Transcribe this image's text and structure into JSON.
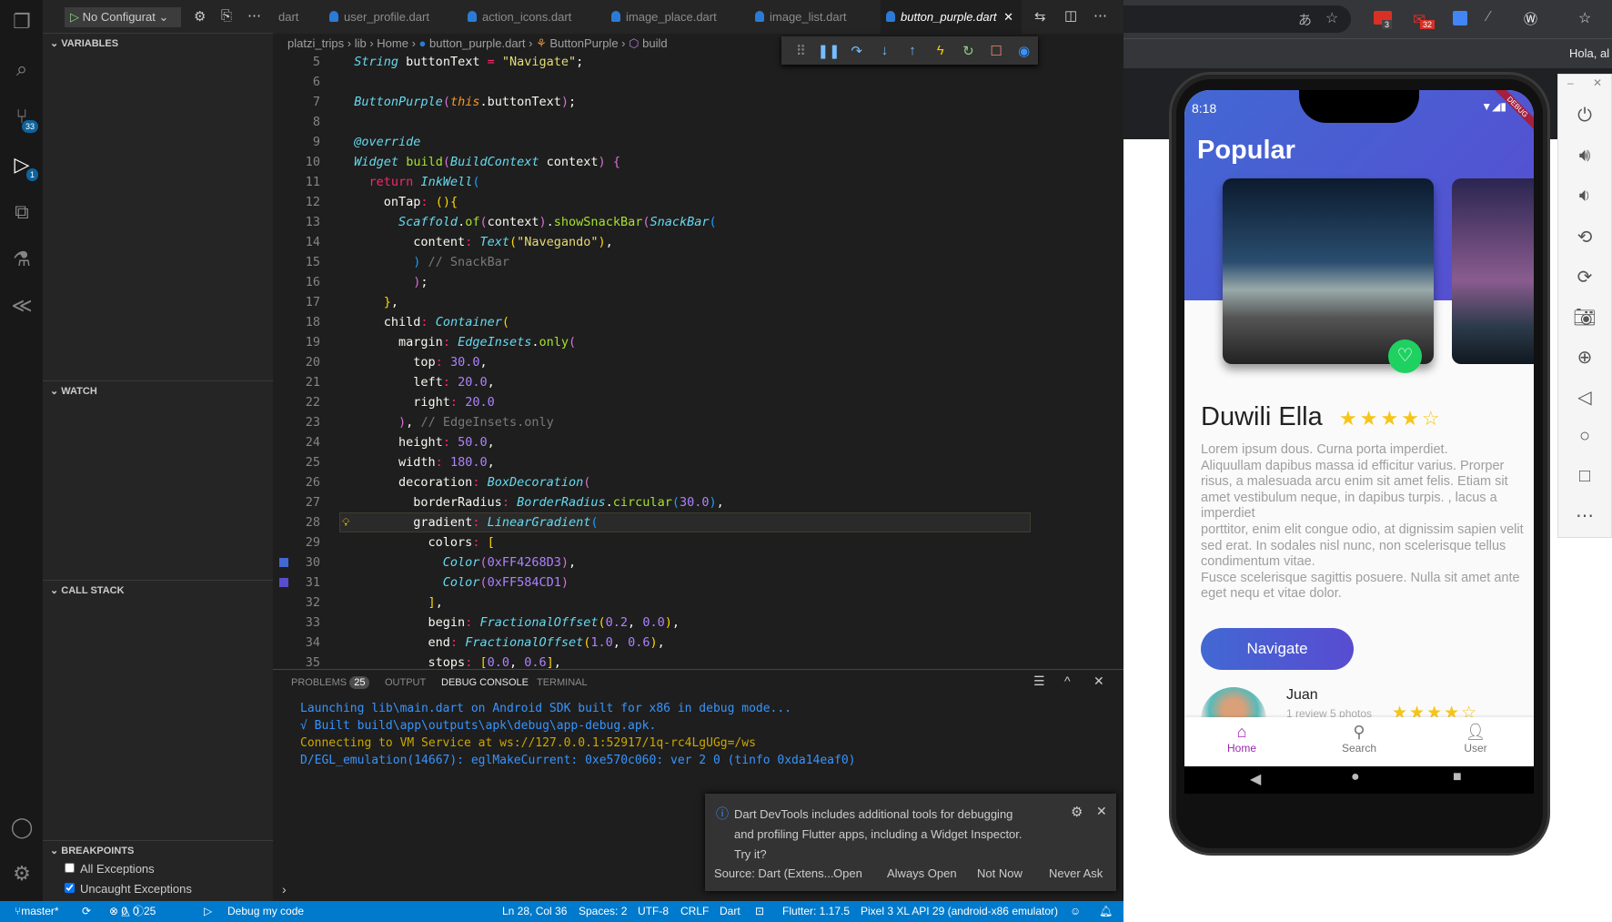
{
  "run": {
    "config": "No Configurat"
  },
  "activity": {
    "scm_badge": "33",
    "debug_badge": "1"
  },
  "sidebar": {
    "variables": "VARIABLES",
    "watch": "WATCH",
    "call_stack": "CALL STACK",
    "breakpoints": "BREAKPOINTS",
    "bp_items": [
      {
        "label": "All Exceptions",
        "checked": false
      },
      {
        "label": "Uncaught Exceptions",
        "checked": true
      }
    ]
  },
  "tabs": [
    {
      "label": "dart"
    },
    {
      "label": "user_profile.dart"
    },
    {
      "label": "action_icons.dart"
    },
    {
      "label": "image_place.dart"
    },
    {
      "label": "image_list.dart"
    },
    {
      "label": "button_purple.dart",
      "active": true
    }
  ],
  "breadcrumb": [
    "platzi_trips",
    "lib",
    "Home",
    "button_purple.dart",
    "ButtonPurple",
    "build"
  ],
  "code": [
    {
      "n": 5,
      "i": 2,
      "t": [
        [
          "t",
          "String"
        ],
        [
          "p",
          " buttonText "
        ],
        [
          "o",
          "="
        ],
        [
          "s",
          " \"Navigate\""
        ],
        [
          "p",
          ";"
        ]
      ]
    },
    {
      "n": 6,
      "i": 0,
      "t": []
    },
    {
      "n": 7,
      "i": 2,
      "t": [
        [
          "t",
          "ButtonPurple"
        ],
        [
          "m",
          "("
        ],
        [
          "h",
          "this"
        ],
        [
          "p",
          ".buttonText"
        ],
        [
          "m",
          ")"
        ],
        [
          "p",
          ";"
        ]
      ]
    },
    {
      "n": 8,
      "i": 0,
      "t": []
    },
    {
      "n": 9,
      "i": 2,
      "t": [
        [
          "t",
          "@override"
        ]
      ]
    },
    {
      "n": 10,
      "i": 2,
      "t": [
        [
          "t",
          "Widget"
        ],
        [
          "p",
          " "
        ],
        [
          "f",
          "build"
        ],
        [
          "m",
          "("
        ],
        [
          "t",
          "BuildContext"
        ],
        [
          "p",
          " context"
        ],
        [
          "m",
          ")"
        ],
        [
          "p",
          " "
        ],
        [
          "m",
          "{"
        ]
      ]
    },
    {
      "n": 11,
      "i": 4,
      "t": [
        [
          "k",
          "return"
        ],
        [
          "p",
          " "
        ],
        [
          "t",
          "InkWell"
        ],
        [
          "u",
          "("
        ]
      ]
    },
    {
      "n": 12,
      "i": 6,
      "t": [
        [
          "p",
          "onTap"
        ],
        [
          "o",
          ":"
        ],
        [
          "p",
          " "
        ],
        [
          "y",
          "(){"
        ]
      ]
    },
    {
      "n": 13,
      "i": 8,
      "t": [
        [
          "t",
          "Scaffold"
        ],
        [
          "p",
          "."
        ],
        [
          "f",
          "of"
        ],
        [
          "m",
          "("
        ],
        [
          "p",
          "context"
        ],
        [
          "m",
          ")"
        ],
        [
          "p",
          "."
        ],
        [
          "f",
          "showSnackBar"
        ],
        [
          "m",
          "("
        ],
        [
          "t",
          "SnackBar"
        ],
        [
          "u",
          "("
        ]
      ]
    },
    {
      "n": 14,
      "i": 10,
      "t": [
        [
          "p",
          "content"
        ],
        [
          "o",
          ":"
        ],
        [
          "p",
          " "
        ],
        [
          "t",
          "Text"
        ],
        [
          "y",
          "("
        ],
        [
          "s",
          "\"Navegando\""
        ],
        [
          "y",
          ")"
        ],
        [
          "p",
          ","
        ]
      ]
    },
    {
      "n": 15,
      "i": 10,
      "t": [
        [
          "u",
          ")"
        ],
        [
          "c",
          " // SnackBar"
        ]
      ]
    },
    {
      "n": 16,
      "i": 10,
      "t": [
        [
          "m",
          ")"
        ],
        [
          "p",
          ";"
        ]
      ]
    },
    {
      "n": 17,
      "i": 6,
      "t": [
        [
          "y",
          "}"
        ],
        [
          "p",
          ","
        ]
      ]
    },
    {
      "n": 18,
      "i": 6,
      "t": [
        [
          "p",
          "child"
        ],
        [
          "o",
          ":"
        ],
        [
          "p",
          " "
        ],
        [
          "t",
          "Container"
        ],
        [
          "y",
          "("
        ]
      ]
    },
    {
      "n": 19,
      "i": 8,
      "t": [
        [
          "p",
          "margin"
        ],
        [
          "o",
          ":"
        ],
        [
          "p",
          " "
        ],
        [
          "t",
          "EdgeInsets"
        ],
        [
          "p",
          "."
        ],
        [
          "f",
          "only"
        ],
        [
          "m",
          "("
        ]
      ]
    },
    {
      "n": 20,
      "i": 10,
      "t": [
        [
          "p",
          "top"
        ],
        [
          "o",
          ":"
        ],
        [
          "p",
          " "
        ],
        [
          "n",
          "30.0"
        ],
        [
          "p",
          ","
        ]
      ]
    },
    {
      "n": 21,
      "i": 10,
      "t": [
        [
          "p",
          "left"
        ],
        [
          "o",
          ":"
        ],
        [
          "p",
          " "
        ],
        [
          "n",
          "20.0"
        ],
        [
          "p",
          ","
        ]
      ]
    },
    {
      "n": 22,
      "i": 10,
      "t": [
        [
          "p",
          "right"
        ],
        [
          "o",
          ":"
        ],
        [
          "p",
          " "
        ],
        [
          "n",
          "20.0"
        ]
      ]
    },
    {
      "n": 23,
      "i": 8,
      "t": [
        [
          "m",
          ")"
        ],
        [
          "p",
          ", "
        ],
        [
          "c",
          "// EdgeInsets.only"
        ]
      ]
    },
    {
      "n": 24,
      "i": 8,
      "t": [
        [
          "p",
          "height"
        ],
        [
          "o",
          ":"
        ],
        [
          "p",
          " "
        ],
        [
          "n",
          "50.0"
        ],
        [
          "p",
          ","
        ]
      ]
    },
    {
      "n": 25,
      "i": 8,
      "t": [
        [
          "p",
          "width"
        ],
        [
          "o",
          ":"
        ],
        [
          "p",
          " "
        ],
        [
          "n",
          "180.0"
        ],
        [
          "p",
          ","
        ]
      ]
    },
    {
      "n": 26,
      "i": 8,
      "t": [
        [
          "p",
          "decoration"
        ],
        [
          "o",
          ":"
        ],
        [
          "p",
          " "
        ],
        [
          "t",
          "BoxDecoration"
        ],
        [
          "m",
          "("
        ]
      ]
    },
    {
      "n": 27,
      "i": 10,
      "t": [
        [
          "p",
          "borderRadius"
        ],
        [
          "o",
          ":"
        ],
        [
          "p",
          " "
        ],
        [
          "t",
          "BorderRadius"
        ],
        [
          "p",
          "."
        ],
        [
          "f",
          "circular"
        ],
        [
          "u",
          "("
        ],
        [
          "n",
          "30.0"
        ],
        [
          "u",
          ")"
        ],
        [
          "p",
          ","
        ]
      ]
    },
    {
      "n": 28,
      "i": 10,
      "t": [
        [
          "p",
          "gradient"
        ],
        [
          "o",
          ":"
        ],
        [
          "p",
          " "
        ],
        [
          "t",
          "LinearGradient"
        ],
        [
          "u",
          "("
        ]
      ]
    },
    {
      "n": 29,
      "i": 12,
      "t": [
        [
          "p",
          "colors"
        ],
        [
          "o",
          ":"
        ],
        [
          "p",
          " "
        ],
        [
          "y",
          "["
        ]
      ]
    },
    {
      "n": 30,
      "i": 14,
      "t": [
        [
          "t",
          "Color"
        ],
        [
          "m",
          "("
        ],
        [
          "n",
          "0xFF4268D3"
        ],
        [
          "m",
          ")"
        ],
        [
          "p",
          ","
        ]
      ]
    },
    {
      "n": 31,
      "i": 14,
      "t": [
        [
          "t",
          "Color"
        ],
        [
          "m",
          "("
        ],
        [
          "n",
          "0xFF584CD1"
        ],
        [
          "m",
          ")"
        ]
      ]
    },
    {
      "n": 32,
      "i": 12,
      "t": [
        [
          "y",
          "]"
        ],
        [
          "p",
          ","
        ]
      ]
    },
    {
      "n": 33,
      "i": 12,
      "t": [
        [
          "p",
          "begin"
        ],
        [
          "o",
          ":"
        ],
        [
          "p",
          " "
        ],
        [
          "t",
          "FractionalOffset"
        ],
        [
          "y",
          "("
        ],
        [
          "n",
          "0.2"
        ],
        [
          "p",
          ", "
        ],
        [
          "n",
          "0.0"
        ],
        [
          "y",
          ")"
        ],
        [
          "p",
          ","
        ]
      ]
    },
    {
      "n": 34,
      "i": 12,
      "t": [
        [
          "p",
          "end"
        ],
        [
          "o",
          ":"
        ],
        [
          "p",
          " "
        ],
        [
          "t",
          "FractionalOffset"
        ],
        [
          "y",
          "("
        ],
        [
          "n",
          "1.0"
        ],
        [
          "p",
          ", "
        ],
        [
          "n",
          "0.6"
        ],
        [
          "y",
          ")"
        ],
        [
          "p",
          ","
        ]
      ]
    },
    {
      "n": 35,
      "i": 12,
      "t": [
        [
          "p",
          "stops"
        ],
        [
          "o",
          ":"
        ],
        [
          "p",
          " "
        ],
        [
          "y",
          "["
        ],
        [
          "n",
          "0.0"
        ],
        [
          "p",
          ", "
        ],
        [
          "n",
          "0.6"
        ],
        [
          "y",
          "]"
        ],
        [
          "p",
          ","
        ]
      ]
    }
  ],
  "current_line": 28,
  "breakpoint_lines": [
    30,
    31
  ],
  "panel": {
    "tabs": [
      {
        "label": "PROBLEMS",
        "badge": "25"
      },
      {
        "label": "OUTPUT"
      },
      {
        "label": "DEBUG CONSOLE",
        "active": true
      },
      {
        "label": "TERMINAL"
      }
    ],
    "console": [
      {
        "text": "Launching lib\\main.dart on Android SDK built for x86 in debug mode...",
        "color": "#3794ff"
      },
      {
        "text": "√ Built build\\app\\outputs\\apk\\debug\\app-debug.apk.",
        "color": "#3794ff"
      },
      {
        "text": "Connecting to VM Service at ws://127.0.0.1:52917/1q-rc4LgUGg=/ws",
        "color": "#cca700"
      },
      {
        "text": "D/EGL_emulation(14667): eglMakeCurrent: 0xe570c060: ver 2 0 (tinfo 0xda14eaf0)",
        "color": "#3794ff"
      }
    ]
  },
  "notification": {
    "message": "Dart DevTools includes additional tools for debugging and profiling Flutter apps, including a Widget Inspector. Try it?",
    "source": "Source: Dart (Extens...",
    "actions": [
      "Open",
      "Always Open",
      "Not Now",
      "Never Ask"
    ]
  },
  "status": {
    "branch": "master*",
    "errors": "0",
    "warnings": "0",
    "info": "25",
    "debug": "Debug my code",
    "position": "Ln 28, Col 36",
    "spaces": "Spaces: 2",
    "encoding": "UTF-8",
    "eol": "CRLF",
    "language": "Dart",
    "flutter": "Flutter: 1.17.5",
    "device": "Pixel 3 XL API 29 (android-x86 emulator)"
  },
  "browser": {
    "ext_badges": [
      "3",
      "32"
    ],
    "greeting": "Hola, al"
  },
  "phone": {
    "time": "8:18",
    "debug_banner": "DEBUG",
    "header": "Popular",
    "place_title": "Duwili Ella",
    "place_rating": 4,
    "description": "Lorem ipsum dous. Curna porta imperdiet.\n Aliquullam dapibus massa id efficitur varius. Prorper risus, a malesuada arcu enim sit amet felis. Etiam sit amet vestibulum neque, in dapibus turpis.  , lacus a imperdiet\nporttitor, enim elit congue odio, at dignissim sapien velit sed erat. In sodales nisl nunc, non scelerisque tellus condimentum vitae.\n Fusce scelerisque sagittis posuere. Nulla sit amet ante eget nequ et vitae dolor.",
    "button": "Navigate",
    "gradient": [
      "#4268D3",
      "#584CD1"
    ],
    "review": {
      "name": "Juan",
      "meta": "1 review 5 photos",
      "rating": 4
    },
    "nav": [
      {
        "label": "Home",
        "active": true
      },
      {
        "label": "Search"
      },
      {
        "label": "User"
      }
    ],
    "accent": "#9c27b0"
  }
}
